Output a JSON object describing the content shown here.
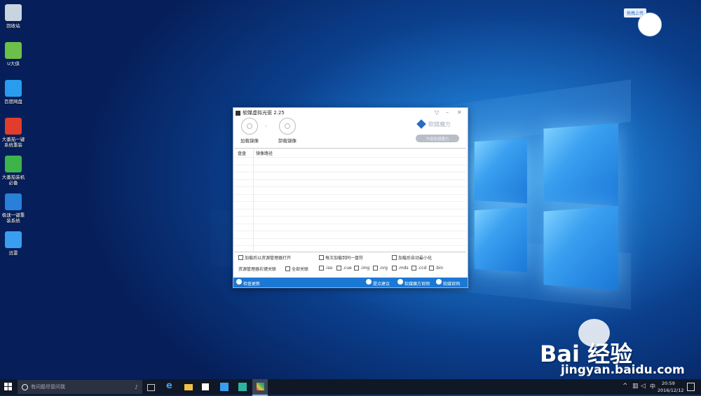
{
  "desktop": {
    "icons": [
      {
        "label": "回收站",
        "color": "#c8d4e0"
      },
      {
        "label": "U大侠",
        "color": "#6cc04a"
      },
      {
        "label": "百度网盘",
        "color": "#2a9cf0"
      },
      {
        "label": "大番茄一键系统重装",
        "color": "#e23c2c"
      },
      {
        "label": "大番茄装机必备",
        "color": "#3cb44a"
      },
      {
        "label": "极速一键重装系统",
        "color": "#2a7fd8"
      },
      {
        "label": "迅雷",
        "color": "#3a9ef0"
      }
    ]
  },
  "upload_widget": {
    "label": "拖拽上传"
  },
  "window": {
    "title": "软媒虚拟光驱 2.25",
    "toolbar": {
      "mount": "加载镜像",
      "unmount": "卸载镜像"
    },
    "brand": "软媒魔方",
    "brand_button": "升级软媒魔方",
    "table": {
      "col_drive": "盘盘",
      "col_path": "镜像路径"
    },
    "options": {
      "open_explorer": "加载后以资源管理器打开",
      "same_drive": "每次加载到同一盘符",
      "auto_minimize": "加载后自动最小化",
      "assoc_label": "资源管理器右键关联",
      "all_assoc": "全部关联",
      "exts": [
        ".iso",
        ".cue",
        ".img",
        ".nrg",
        ".mds",
        ".ccd",
        ".bin"
      ]
    },
    "status": {
      "update": "检查更新",
      "feedback": "提点建议",
      "mofang_site": "软媒魔方官网",
      "ruanmei_site": "软媒官网"
    }
  },
  "taskbar": {
    "search_placeholder": "有问题尽管问我",
    "time": "20:59",
    "date": "2016/12/12",
    "ime": "中"
  },
  "watermark": {
    "brand": "Bai 经验",
    "url": "jingyan.baidu.com"
  }
}
